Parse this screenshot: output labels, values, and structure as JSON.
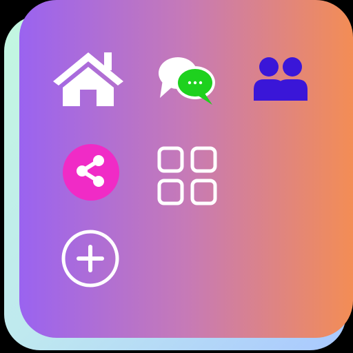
{
  "widget": {
    "colors": {
      "front_gradient": [
        "#9a63f0",
        "#c67ab7",
        "#f38d55"
      ],
      "back_gradient": [
        "#c3f7e0",
        "#bfe9ef",
        "#a9c8ff"
      ],
      "message_bubble": "#1ed11e",
      "contacts": "#3a16d8",
      "share": "#f02bc6"
    },
    "icons": [
      {
        "id": "home",
        "icon": "home-icon"
      },
      {
        "id": "messages",
        "icon": "chat-bubbles-icon"
      },
      {
        "id": "contacts",
        "icon": "people-icon"
      },
      {
        "id": "share",
        "icon": "share-icon"
      },
      {
        "id": "apps",
        "icon": "grid-apps-icon"
      },
      {
        "id": "add",
        "icon": "add-circle-icon"
      }
    ]
  }
}
